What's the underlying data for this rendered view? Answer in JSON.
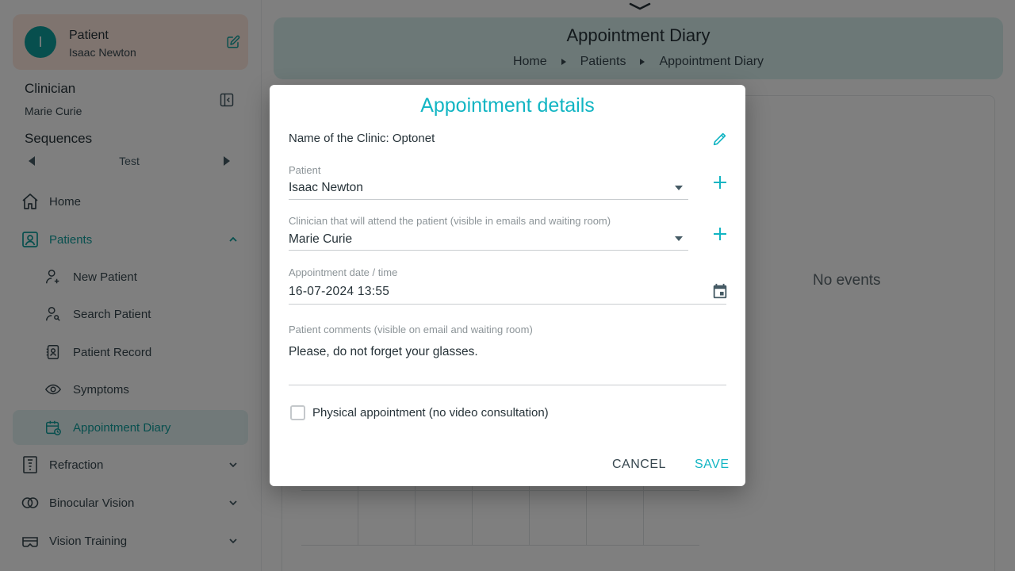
{
  "colors": {
    "accent": "#12b5c3",
    "teal": "#0e9e9c",
    "patient_card_bg": "#ffe9df",
    "header_bg": "#d8f0ee",
    "overlay": "rgba(0,0,0,0.5)"
  },
  "sidebar": {
    "patient_card": {
      "avatar_letter": "I",
      "title": "Patient",
      "name": "Isaac Newton",
      "edit_icon": "edit-icon"
    },
    "clinician": {
      "title": "Clinician",
      "name": "Marie Curie"
    },
    "sequences": {
      "title": "Sequences",
      "value": "Test"
    },
    "nav": {
      "home": {
        "label": "Home",
        "icon": "home-icon"
      },
      "patients": {
        "label": "Patients",
        "icon": "patient-icon",
        "expanded": true
      },
      "new_patient": {
        "label": "New Patient",
        "icon": "user-plus-icon"
      },
      "search_patient": {
        "label": "Search Patient",
        "icon": "user-search-icon"
      },
      "patient_record": {
        "label": "Patient Record",
        "icon": "record-icon"
      },
      "symptoms": {
        "label": "Symptoms",
        "icon": "eye-icon"
      },
      "appointment_diary": {
        "label": "Appointment Diary",
        "icon": "calendar-icon",
        "active": true
      },
      "refraction": {
        "label": "Refraction",
        "icon": "eye-chart-icon"
      },
      "binocular_vision": {
        "label": "Binocular Vision",
        "icon": "binocular-icon"
      },
      "vision_training": {
        "label": "Vision Training",
        "icon": "vr-glasses-icon"
      }
    }
  },
  "header": {
    "title": "Appointment Diary",
    "breadcrumb": [
      "Home",
      "Patients",
      "Appointment Diary"
    ]
  },
  "calendar": {
    "empty_text": "No events"
  },
  "modal": {
    "title": "Appointment details",
    "clinic_line": "Name of the Clinic: Optonet",
    "patient": {
      "label": "Patient",
      "value": "Isaac Newton"
    },
    "clinician": {
      "label": "Clinician that will attend the patient (visible in emails and waiting room)",
      "value": "Marie Curie"
    },
    "datetime": {
      "label": "Appointment date / time",
      "value": "16-07-2024 13:55"
    },
    "comments": {
      "label": "Patient comments (visible on email and waiting room)",
      "value": "Please, do not forget your glasses."
    },
    "physical": {
      "label": "Physical appointment (no video consultation)",
      "checked": false
    },
    "cancel_label": "CANCEL",
    "save_label": "SAVE"
  }
}
